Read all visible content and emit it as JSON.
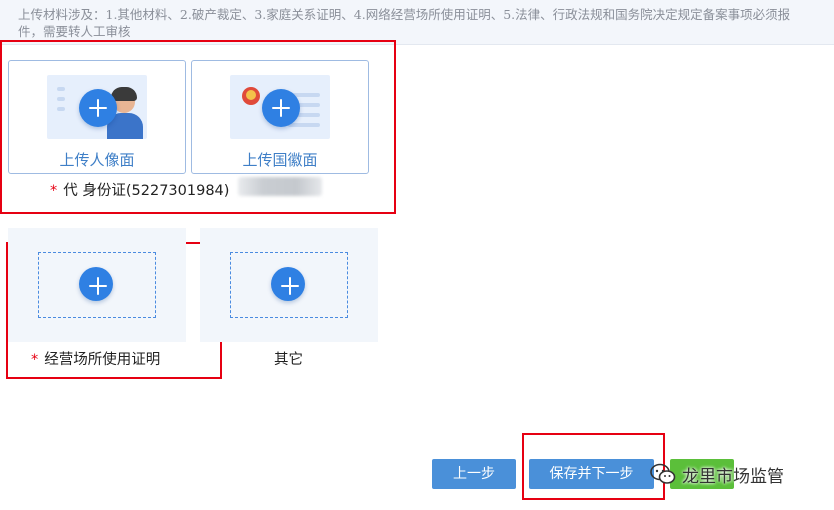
{
  "notice": {
    "line1": "上传材料涉及：1.其他材料、2.破产裁定、3.家庭关系证明、4.网络经营场所使用证明、5.法律、行政法规和国务院决定规定备案事项必须报",
    "line2": "件，需要转人工审核"
  },
  "id_upload": {
    "portrait_label": "上传人像面",
    "emblem_label": "上传国徽面",
    "caption_required": "*",
    "caption_text": "代  身份证(5227301984)"
  },
  "uploads": [
    {
      "label": "经营场所使用证明",
      "required": "*"
    },
    {
      "label": "其它",
      "required": ""
    }
  ],
  "buttons": {
    "prev": "上一步",
    "save_next": "保存并下一步"
  },
  "watermark": {
    "text": "龙里市场监管",
    "icon": "wechat-icon"
  },
  "colors": {
    "accent": "#2f80e3",
    "highlight": "#e60012",
    "button": "#4a90d9"
  }
}
